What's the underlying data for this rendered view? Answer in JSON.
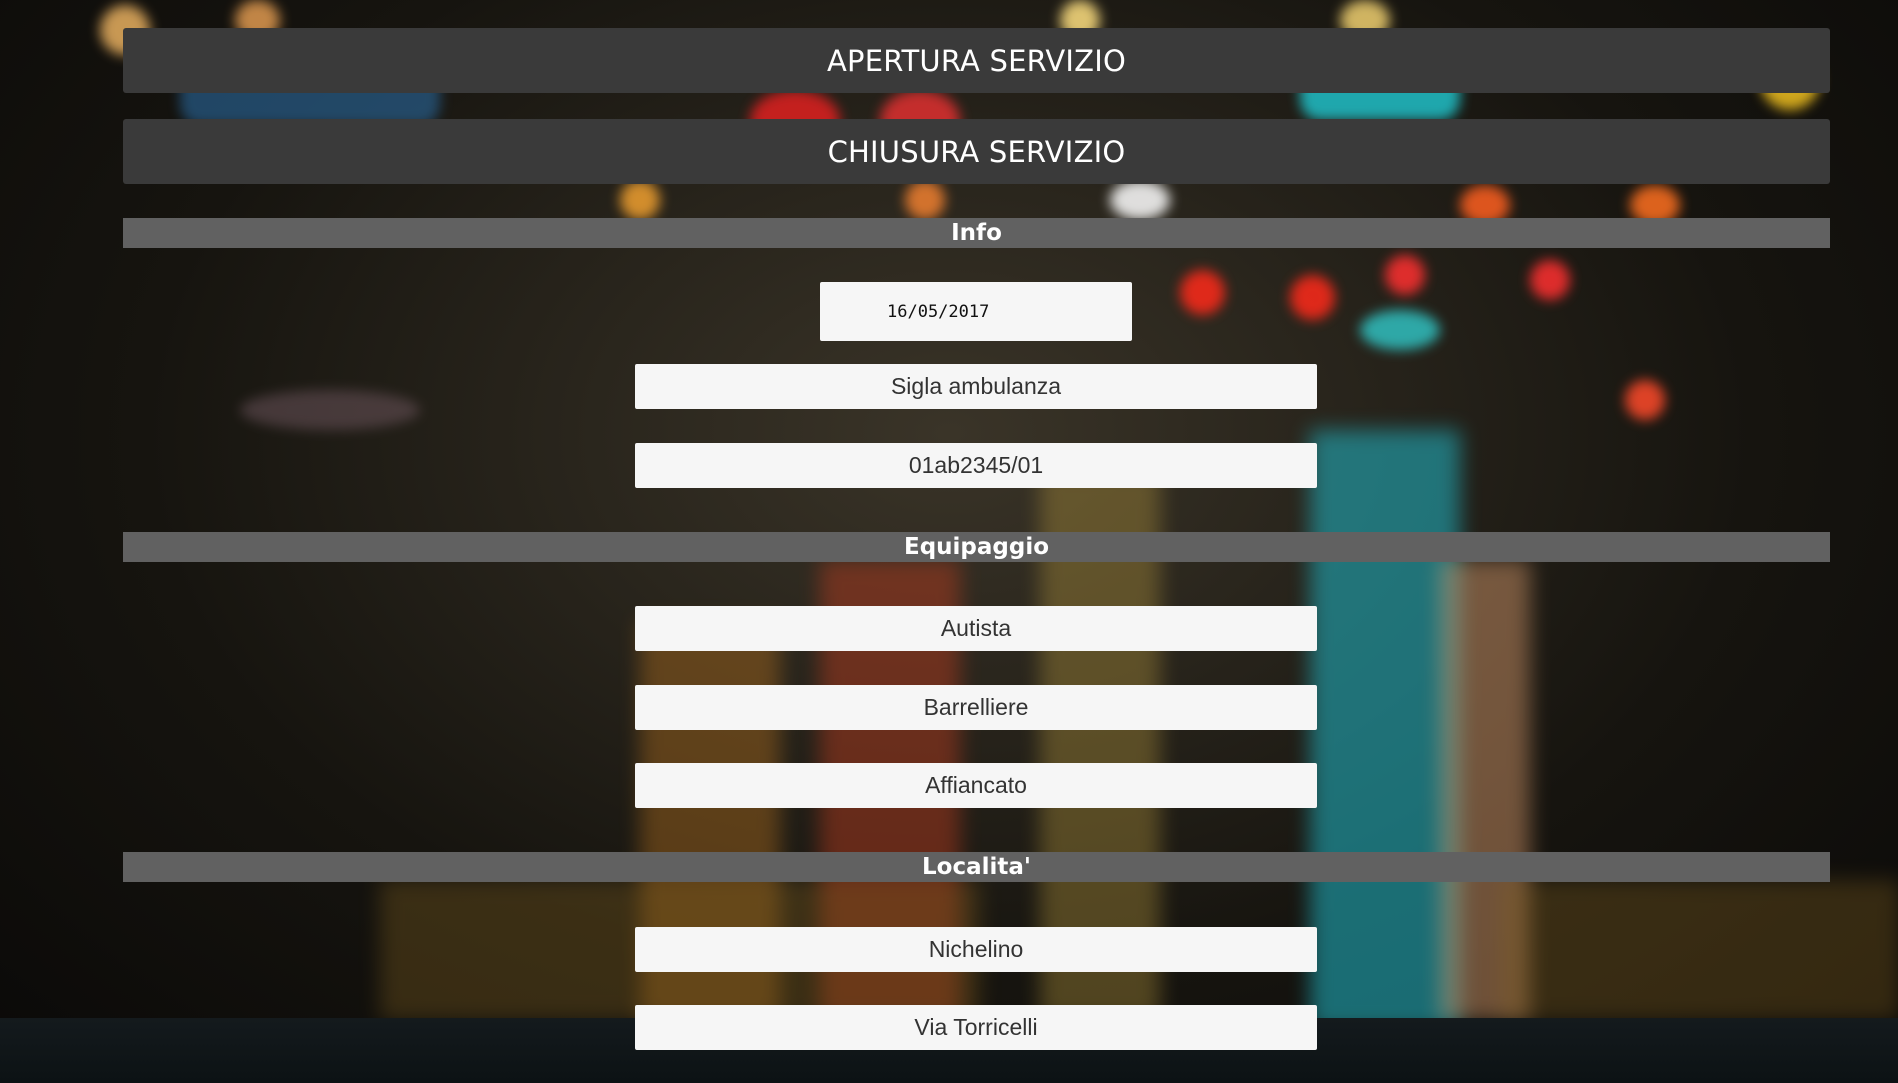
{
  "buttons": {
    "open_service": "APERTURA SERVIZIO",
    "close_service": "CHIUSURA SERVIZIO"
  },
  "sections": {
    "info": "Info",
    "crew": "Equipaggio",
    "location": "Localita'"
  },
  "info": {
    "date": "16/05/2017",
    "ambulance_code_placeholder": "Sigla ambulanza",
    "ambulance_code_value": "01ab2345/01"
  },
  "crew": {
    "driver": "Autista",
    "stretcher_bearer": "Barrelliere",
    "trainee": "Affiancato"
  },
  "location": {
    "city": "Nichelino",
    "street": "Via Torricelli"
  },
  "colors": {
    "button_bg": "#3a3a3a",
    "section_bg": "#616161",
    "field_bg": "#f6f6f6"
  }
}
